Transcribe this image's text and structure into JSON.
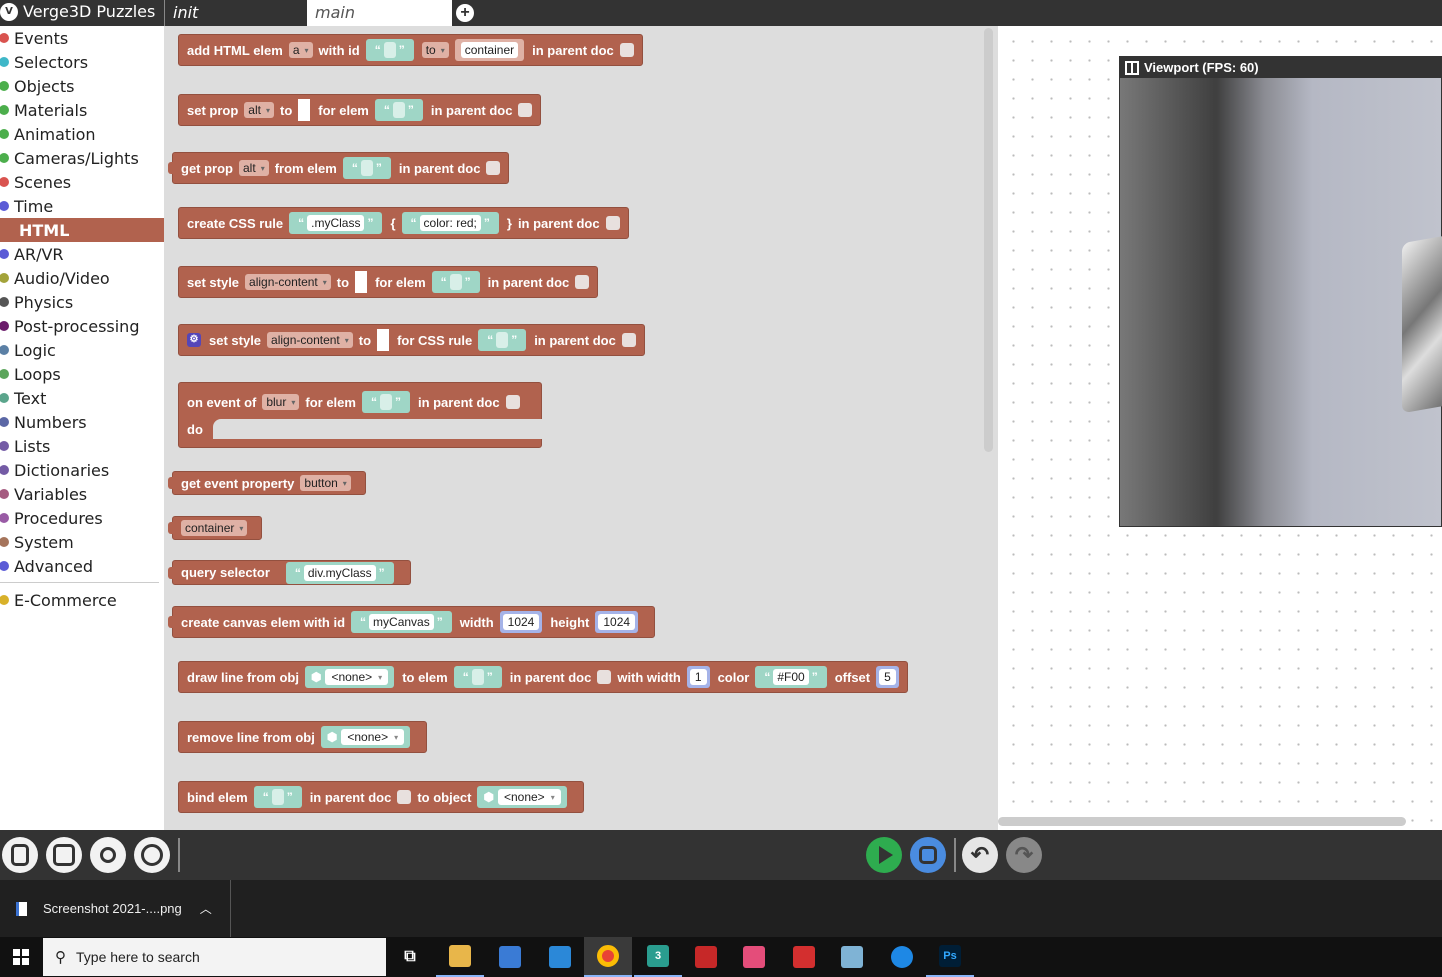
{
  "app": {
    "title": "Verge3D Puzzles",
    "tabs": [
      {
        "label": "init"
      },
      {
        "label": "main"
      }
    ]
  },
  "sidebar": {
    "items": [
      {
        "label": "Events",
        "color": "#d9534f"
      },
      {
        "label": "Selectors",
        "color": "#3fb7c8"
      },
      {
        "label": "Objects",
        "color": "#4cae4c"
      },
      {
        "label": "Materials",
        "color": "#4cae4c"
      },
      {
        "label": "Animation",
        "color": "#4cae4c"
      },
      {
        "label": "Cameras/Lights",
        "color": "#4cae4c"
      },
      {
        "label": "Scenes",
        "color": "#d9534f"
      },
      {
        "label": "Time",
        "color": "#5b5bd6"
      },
      {
        "label": "HTML",
        "color": "#b1624e"
      },
      {
        "label": "AR/VR",
        "color": "#5b5bd6"
      },
      {
        "label": "Audio/Video",
        "color": "#a3a33a"
      },
      {
        "label": "Physics",
        "color": "#555555"
      },
      {
        "label": "Post-processing",
        "color": "#6b1c6b"
      },
      {
        "label": "Logic",
        "color": "#5b80a5"
      },
      {
        "label": "Loops",
        "color": "#5ba55b"
      },
      {
        "label": "Text",
        "color": "#5ba58c"
      },
      {
        "label": "Numbers",
        "color": "#5b67a5"
      },
      {
        "label": "Lists",
        "color": "#745ba5"
      },
      {
        "label": "Dictionaries",
        "color": "#745ba5"
      },
      {
        "label": "Variables",
        "color": "#a55b80"
      },
      {
        "label": "Procedures",
        "color": "#995ba5"
      },
      {
        "label": "System",
        "color": "#a5745b"
      },
      {
        "label": "Advanced",
        "color": "#5b5bd6"
      }
    ],
    "extra": {
      "label": "E-Commerce",
      "color": "#d8b12a"
    }
  },
  "blocks": {
    "add_html": {
      "l1": "add HTML elem",
      "dd1": "a",
      "l2": "with id",
      "l3": "to",
      "dd2": "to",
      "dd3": "container",
      "l4": "in parent doc"
    },
    "set_prop": {
      "l1": "set prop",
      "dd1": "alt",
      "l2": "to",
      "l3": "for elem",
      "l4": "in parent doc"
    },
    "get_prop": {
      "l1": "get prop",
      "dd1": "alt",
      "l2": "from elem",
      "l3": "in parent doc"
    },
    "css_rule": {
      "l1": "create CSS rule",
      "s1": ".myClass",
      "brace_open": "{",
      "s2": "color: red;",
      "brace_close": "}",
      "l2": "in parent doc"
    },
    "set_style": {
      "l1": "set style",
      "dd1": "align-content",
      "l2": "to",
      "l3": "for elem",
      "l4": "in parent doc"
    },
    "set_style_css": {
      "gear": "⚙",
      "l1": "set style",
      "dd1": "align-content",
      "l2": "to",
      "l3": "for CSS rule",
      "l4": "in parent doc"
    },
    "on_event": {
      "l1": "on event of",
      "dd1": "blur",
      "l2": "for elem",
      "l3": "in parent doc",
      "l4": "do"
    },
    "get_event": {
      "l1": "get event property",
      "dd1": "button"
    },
    "container": {
      "dd1": "container"
    },
    "query": {
      "l1": "query selector",
      "s1": "div.myClass"
    },
    "canvas": {
      "l1": "create canvas elem with id",
      "s1": "myCanvas",
      "l2": "width",
      "n1": "1024",
      "l3": "height",
      "n2": "1024"
    },
    "draw_line": {
      "l1": "draw line from obj",
      "o1": "<none>",
      "l2": "to elem",
      "l3": "in parent doc",
      "l4": "with width",
      "n1": "1",
      "l5": "color",
      "s1": "#F00",
      "l6": "offset",
      "n2": "5"
    },
    "remove_line": {
      "l1": "remove line from obj",
      "o1": "<none>"
    },
    "bind": {
      "l1": "bind elem",
      "l2": "in parent doc",
      "l3": "to object",
      "o1": "<none>"
    }
  },
  "viewport": {
    "title": "Viewport (FPS: 60)"
  },
  "download": {
    "file": "Screenshot 2021-....png"
  },
  "taskbar": {
    "search_placeholder": "Type here to search"
  }
}
